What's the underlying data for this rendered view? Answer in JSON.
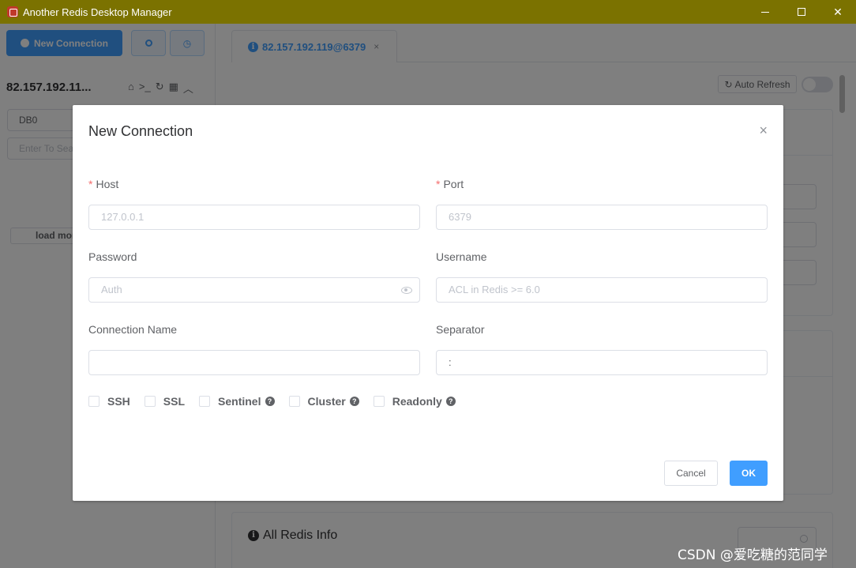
{
  "window": {
    "title": "Another Redis Desktop Manager",
    "controls": [
      "minimize",
      "maximize",
      "close"
    ]
  },
  "sidebar": {
    "new_connection_label": "New Connection",
    "connection_name": "82.157.192.11...",
    "db_value": "DB0",
    "search_placeholder": "Enter To Search",
    "load_more_label": "load more"
  },
  "tabs": [
    {
      "label": "82.157.192.119@6379",
      "close": "×"
    }
  ],
  "toolbar": {
    "auto_refresh_label": "Auto Refresh",
    "auto_refresh_on": false
  },
  "panels": {
    "redis_info_title": "All Redis Info"
  },
  "dialog": {
    "title": "New Connection",
    "close": "×",
    "fields": {
      "host": {
        "label": "Host",
        "required": true,
        "placeholder": "127.0.0.1",
        "value": ""
      },
      "port": {
        "label": "Port",
        "required": true,
        "placeholder": "6379",
        "value": ""
      },
      "password": {
        "label": "Password",
        "placeholder": "Auth",
        "value": ""
      },
      "username": {
        "label": "Username",
        "placeholder": "ACL in Redis >= 6.0",
        "value": ""
      },
      "connection_name": {
        "label": "Connection Name",
        "placeholder": "",
        "value": ""
      },
      "separator": {
        "label": "Separator",
        "placeholder": "",
        "value": ":"
      }
    },
    "checkboxes": [
      {
        "label": "SSH",
        "checked": false,
        "help": false
      },
      {
        "label": "SSL",
        "checked": false,
        "help": false
      },
      {
        "label": "Sentinel",
        "checked": false,
        "help": true
      },
      {
        "label": "Cluster",
        "checked": false,
        "help": true
      },
      {
        "label": "Readonly",
        "checked": false,
        "help": true
      }
    ],
    "cancel_label": "Cancel",
    "ok_label": "OK"
  },
  "watermark": "CSDN @爱吃糖的范同学",
  "colors": {
    "titlebar": "#7b7200",
    "primary": "#409eff",
    "required": "#f56c6c"
  }
}
